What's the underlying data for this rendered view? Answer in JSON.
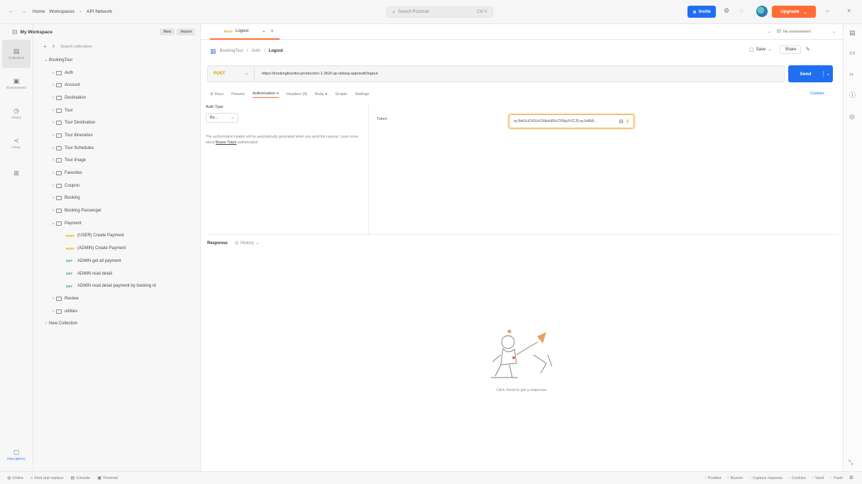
{
  "topbar": {
    "nav": [
      "←",
      "→"
    ],
    "home": "Home",
    "workspaces": "Workspaces",
    "api_network": "API Network",
    "search_placeholder": "Search Postman",
    "search_shortcut": "Ctrl K",
    "invite": "Invite",
    "upgrade": "Upgrade"
  },
  "rail": {
    "items": [
      {
        "label": "Collections",
        "icon": "collections-icon"
      },
      {
        "label": "Environments",
        "icon": "environments-icon"
      },
      {
        "label": "History",
        "icon": "history-icon"
      },
      {
        "label": "Flows",
        "icon": "flows-icon"
      },
      {
        "label": "",
        "icon": "grid-icon"
      }
    ],
    "bottom_label": "Files (BETA)"
  },
  "sidebar": {
    "workspace": "My Workspace",
    "new_label": "New",
    "import_label": "Import",
    "search_placeholder": "Search collections",
    "root": "BookingTour",
    "folders": [
      "Auth",
      "Account",
      "Destination",
      "Tour",
      "Tour Destination",
      "Tour Itineraries",
      "Tour Schedules",
      "Tour Image",
      "Favorites",
      "Coupon",
      "Booking",
      "Booking Passenger",
      "Payment"
    ],
    "payment_requests": [
      {
        "method": "POST",
        "name": "(USER) Create Payment"
      },
      {
        "method": "POST",
        "name": "(ADMIN) Create Payment"
      },
      {
        "method": "GET",
        "name": "ADMIN get all payment"
      },
      {
        "method": "GET",
        "name": "ADMIN read detail"
      },
      {
        "method": "GET",
        "name": "ADMIN read detail payment by booking id"
      }
    ],
    "after_folders": [
      "Review",
      "utilities"
    ],
    "new_collection": "New Collection"
  },
  "tabs": {
    "active": {
      "method": "POST",
      "label": "Logout"
    },
    "environment": "No environment"
  },
  "request": {
    "breadcrumb": [
      "BookingTour",
      "Auth",
      "Logout"
    ],
    "save_label": "Save",
    "share_label": "Share",
    "method": "POST",
    "url": "https://bookingtourdev.production-1-3b2f.up.railway.app/auth/logout",
    "send_label": "Send",
    "subtabs": [
      "Docs",
      "Params",
      "Authorization",
      "Headers (9)",
      "Body",
      "Scripts",
      "Settings"
    ],
    "cookies": "Cookies"
  },
  "auth": {
    "type_label": "Auth Type",
    "type_value": "Be...",
    "note": "The authorization header will be automatically generated when you send the request. Learn more about ",
    "note_link": "Bearer Token",
    "note_tail": " authorization.",
    "token_label": "Token",
    "token_value": "eyJhbGciOiJIUzI1NiIsInR5cCI6IkpXVCJ9.eyJzdWIi…"
  },
  "response": {
    "title": "Response",
    "history": "History",
    "empty_caption": "Click Send to get a response"
  },
  "statusbar": {
    "left": [
      "Online",
      "Find and replace",
      "Console",
      "Terminal"
    ],
    "right": [
      "Postbot",
      "Runner",
      "Capture requests",
      "Cookies",
      "Vault",
      "Trash"
    ]
  }
}
